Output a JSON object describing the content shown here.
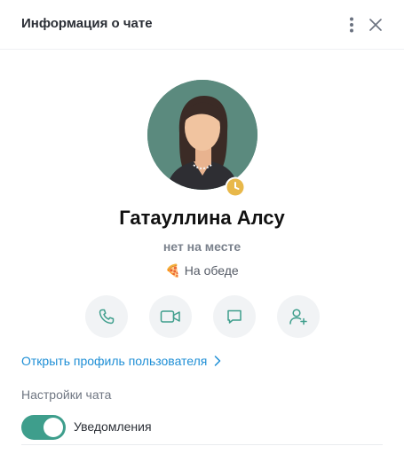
{
  "header": {
    "title": "Информация о чате",
    "menu_icon": "more-vertical-icon",
    "close_icon": "close-icon"
  },
  "user": {
    "name": "Гатауллина Алсу",
    "presence": "нет на месте",
    "custom_status_emoji": "🍕",
    "custom_status_text": "На обеде",
    "status_badge_icon": "clock-icon"
  },
  "actions": [
    {
      "icon": "phone-icon"
    },
    {
      "icon": "video-camera-icon"
    },
    {
      "icon": "chat-bubble-icon"
    },
    {
      "icon": "add-user-icon"
    }
  ],
  "profile_link": {
    "label": "Открыть профиль пользователя"
  },
  "chat_settings": {
    "title": "Настройки чата",
    "notifications_label": "Уведомления",
    "notifications_on": true
  },
  "colors": {
    "accent_link": "#1f8fd6",
    "toggle_on": "#3e9e8c",
    "avatar_bg": "#5b8a7e",
    "status_badge": "#e8b84a"
  }
}
